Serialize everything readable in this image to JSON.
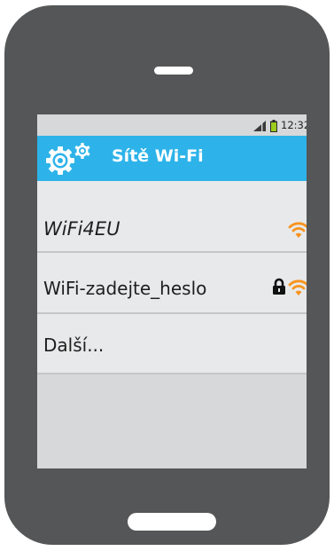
{
  "status_bar": {
    "time": "12:32",
    "signal_icon": "signal-icon",
    "battery_icon": "battery-icon",
    "battery_color": "#9ccc1e"
  },
  "header": {
    "title": "Sítě Wi-Fi",
    "icon": "gears-icon",
    "background_color": "#2db3e9"
  },
  "networks": [
    {
      "name": "WiFi4EU",
      "secured": false,
      "signal_icon": "wifi-signal-icon"
    },
    {
      "name": "WiFi-zadejte_heslo",
      "secured": true,
      "signal_icon": "wifi-signal-icon",
      "lock_icon": "lock-icon"
    }
  ],
  "more_label": "Další...",
  "accent_color": "#f7941d"
}
